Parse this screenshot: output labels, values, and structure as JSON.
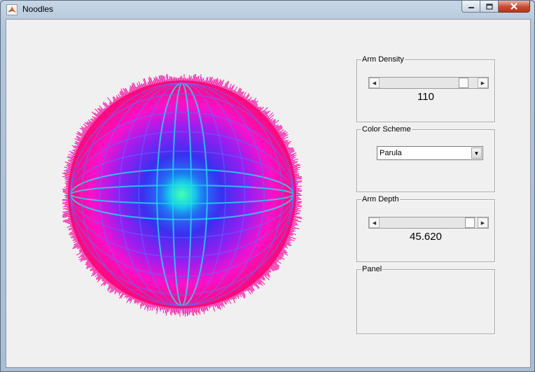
{
  "window": {
    "title": "Noodles"
  },
  "icons": {
    "app": "matlab-icon",
    "minimize": "minimize-icon",
    "maximize": "maximize-icon",
    "close": "close-icon"
  },
  "controls": {
    "arm_density": {
      "title": "Arm Density",
      "value": "110",
      "slider_level": 0.9
    },
    "color_scheme": {
      "title": "Color Scheme",
      "selected": "Parula"
    },
    "arm_depth": {
      "title": "Arm Depth",
      "value": "45.620",
      "slider_level": 0.97
    },
    "panel": {
      "title": "Panel"
    }
  },
  "plot": {
    "description_colors": {
      "outer": "#ff0a8c",
      "mid": "#4b35f0",
      "core": "#17f0c8"
    }
  }
}
